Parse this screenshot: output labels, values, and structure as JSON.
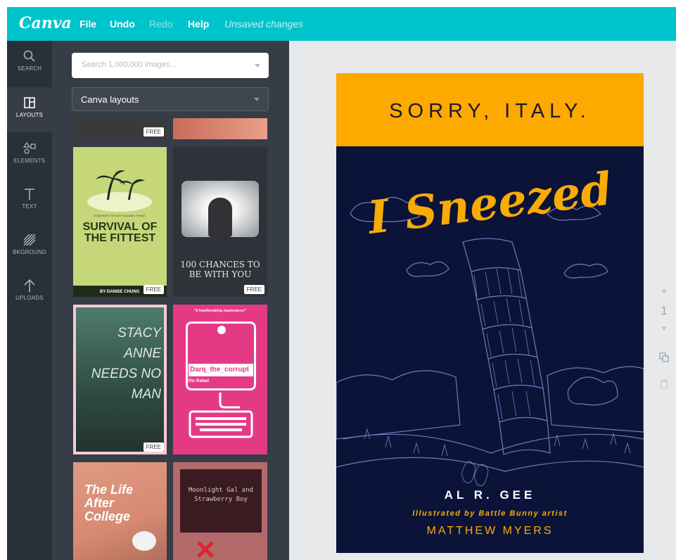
{
  "app": {
    "logo": "Canva",
    "accent": "#00c4cc"
  },
  "menu": {
    "file": "File",
    "undo": "Undo",
    "redo": "Redo",
    "help": "Help",
    "status": "Unsaved changes"
  },
  "rail": [
    {
      "label": "SEARCH",
      "icon": "search-icon"
    },
    {
      "label": "LAYOUTS",
      "icon": "layouts-icon",
      "active": true
    },
    {
      "label": "ELEMENTS",
      "icon": "elements-icon"
    },
    {
      "label": "TEXT",
      "icon": "text-icon"
    },
    {
      "label": "BKGROUND",
      "icon": "background-icon"
    },
    {
      "label": "UPLOADS",
      "icon": "upload-icon"
    }
  ],
  "panel": {
    "search_placeholder": "Search 1,000,000 images...",
    "dropdown_value": "Canva layouts",
    "free_badge": "FREE",
    "thumbs": {
      "t1_title": "SURVIVAL OF THE FITTEST",
      "t1_by": "BY DANISE CHUNG",
      "t2_title": "100 CHANCES TO BE WITH YOU",
      "t3_title": "STACY ANNE NEEDS NO MAN",
      "t4_quote": "\"A heartbreaking masterpiece!\"",
      "t4_name": "Darq_the_corrupt",
      "t4_author": "Ric Rafael",
      "t5_title": "The Life After College",
      "t6_title": "Moonlight Gal and Strawberry Boy"
    }
  },
  "poster": {
    "title": "SORRY, ITALY.",
    "headline": "I Sneezed",
    "author": "AL R. GEE",
    "illustrated_by": "Illustrated by Battle Bunny artist",
    "artist": "MATTHEW MYERS",
    "colors": {
      "banner": "#fea900",
      "background": "#0c1339",
      "accent": "#f9ab05"
    }
  },
  "page_controls": {
    "page_number": "1"
  }
}
